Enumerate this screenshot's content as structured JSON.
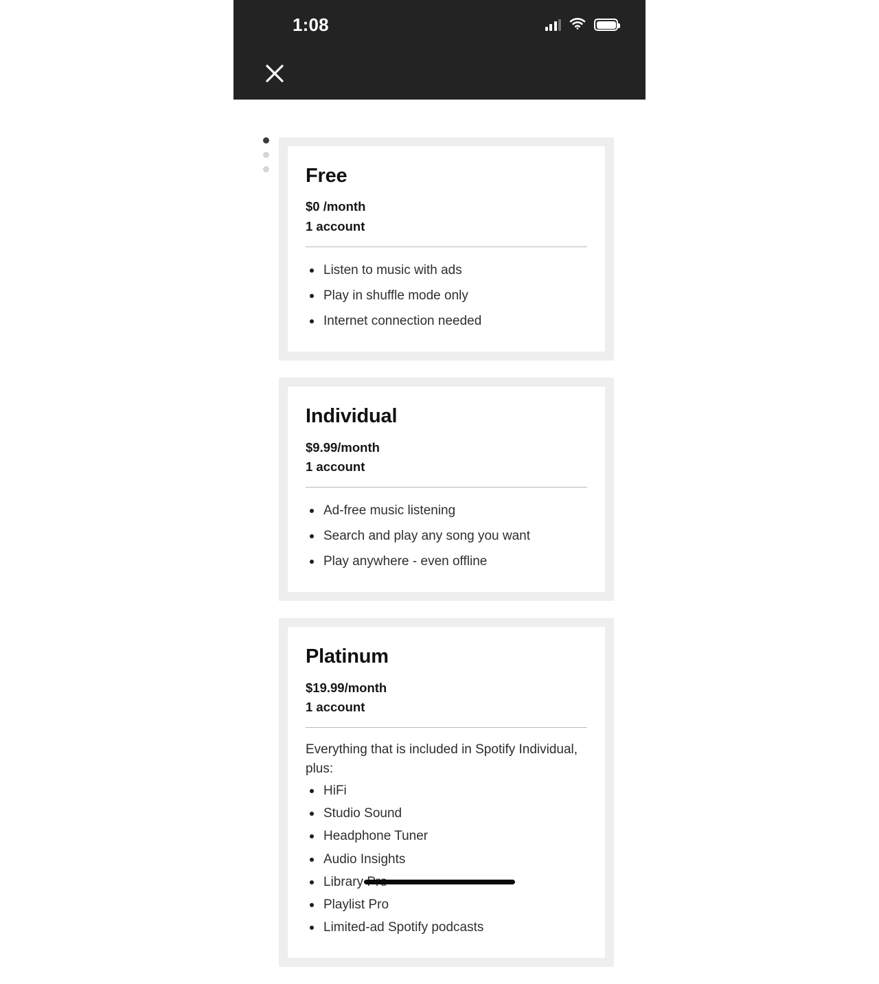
{
  "status_bar": {
    "time": "1:08",
    "signal_icon": "signal-bars-icon",
    "wifi_icon": "wifi-icon",
    "battery_icon": "battery-icon"
  },
  "nav": {
    "close_icon": "close-x-icon"
  },
  "carousel": {
    "dots": [
      {
        "index": 1,
        "active": true
      },
      {
        "index": 2,
        "active": false
      },
      {
        "index": 3,
        "active": false
      }
    ]
  },
  "plans": [
    {
      "title": "Free",
      "price": "$0 /month",
      "accounts": "1 account",
      "intro": "",
      "features": [
        "Listen to music with ads",
        "Play in shuffle mode only",
        "Internet connection needed"
      ]
    },
    {
      "title": "Individual",
      "price": "$9.99/month",
      "accounts": "1 account",
      "intro": "",
      "features": [
        "Ad-free music listening",
        "Search and play any song you want",
        "Play anywhere - even offline"
      ]
    },
    {
      "title": "Platinum",
      "price": "$19.99/month",
      "accounts": "1 account",
      "intro": "Everything that is included in Spotify Individual, plus:",
      "features": [
        "HiFi",
        "Studio Sound",
        "Headphone Tuner",
        "Audio Insights",
        "Library Pro",
        "Playlist Pro",
        "Limited-ad Spotify podcasts"
      ]
    }
  ],
  "colors": {
    "header_background": "#232323",
    "card_frame": "#eeeeee",
    "card_background": "#ffffff",
    "title_text": "#111111",
    "body_text": "#2f2f2f",
    "divider": "#b9b9b9",
    "dot_active": "#3a3a3a",
    "dot_inactive": "#d6d6d6",
    "home_indicator": "#0a0a0a"
  }
}
